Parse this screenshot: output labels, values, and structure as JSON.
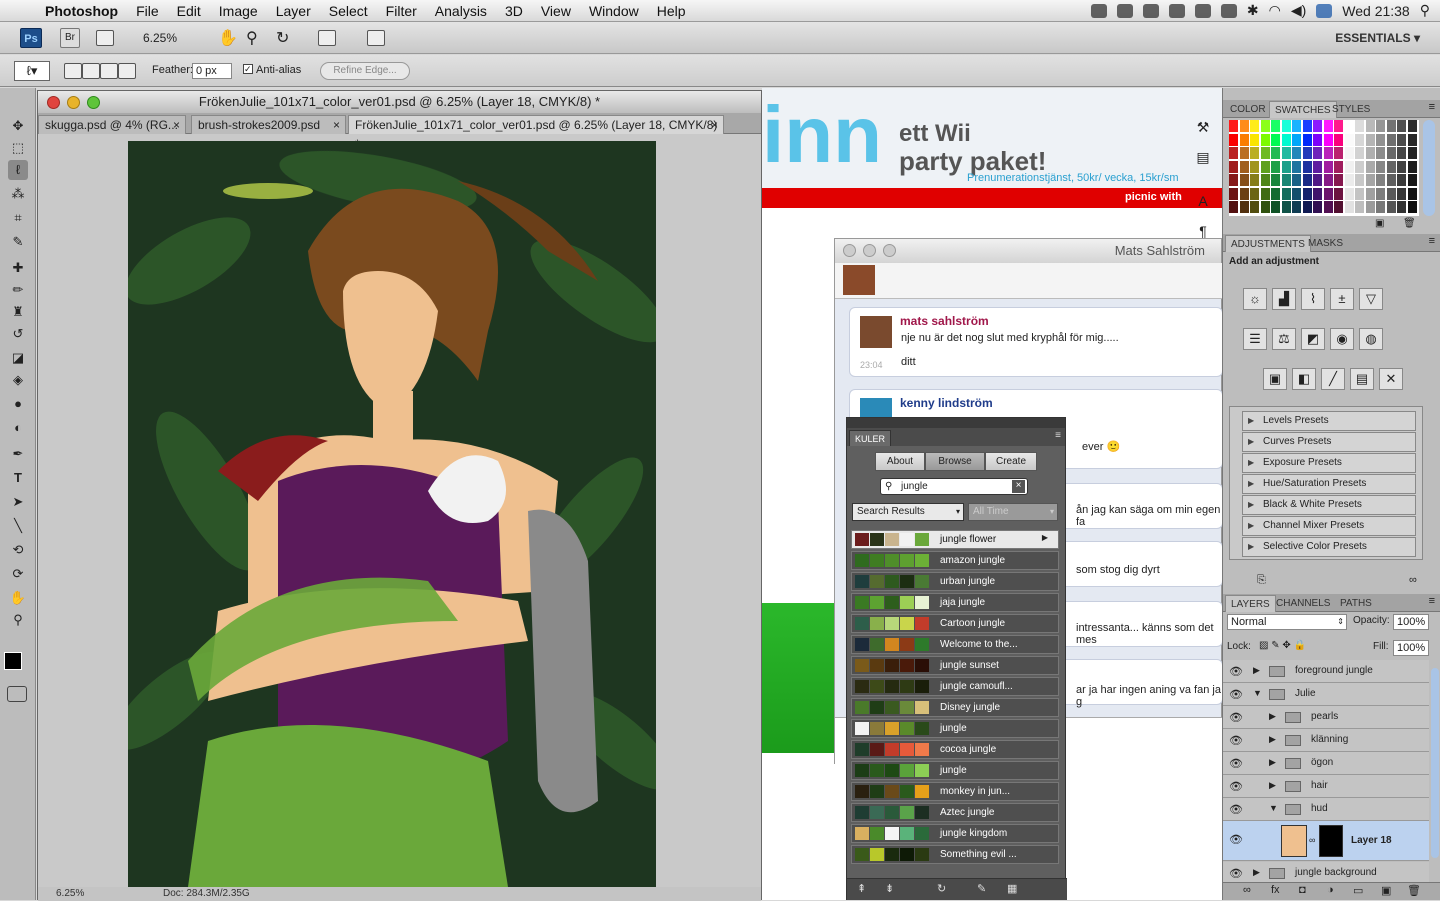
{
  "menubar": {
    "items": [
      "Photoshop",
      "File",
      "Edit",
      "Image",
      "Layer",
      "Select",
      "Filter",
      "Analysis",
      "3D",
      "View",
      "Window",
      "Help"
    ],
    "clock": "Wed 21:38"
  },
  "appbar": {
    "ps": "Ps",
    "br": "Br",
    "zoom": "6.25%",
    "workspace": "ESSENTIALS ▾"
  },
  "options": {
    "feather_label": "Feather:",
    "feather_value": "0 px",
    "antialias": "Anti-alias",
    "refine": "Refine Edge..."
  },
  "doc": {
    "title": "FrökenJulie_101x71_color_ver01.psd @ 6.25% (Layer 18, CMYK/8) *",
    "tabs": [
      "skugga.psd @ 4% (RG...",
      "brush-strokes2009.psd",
      "FrökenJulie_101x71_color_ver01.psd @ 6.25% (Layer 18, CMYK/8) *"
    ],
    "status_zoom": "6.25%",
    "status_doc": "Doc: 284.3M/2.35G"
  },
  "web": {
    "banner_line1": "ett Wii",
    "banner_line2": "party paket!",
    "banner_sub": "Prenumerationstjänst, 50kr/ vecka, 15kr/sm",
    "redbar": "picnic with",
    "logo": "inn"
  },
  "chat": {
    "title": "Mats Sahlström",
    "messages": [
      {
        "name": "mats sahlström",
        "lines": [
          "nje nu är det nog slut med kryphål för mig.....",
          "ditt"
        ],
        "time": "23:04"
      },
      {
        "name": "kenny lindström",
        "lines": [
          "ever 🙂"
        ]
      }
    ],
    "fragments": [
      "ån jag kan säga om min egen fa",
      "som stog dig dyrt",
      "intressanta... känns som det mes",
      "ar ja har ingen aning va fan ja g"
    ]
  },
  "kuler": {
    "tab": "KULER",
    "buttons": [
      "About",
      "Browse",
      "Create"
    ],
    "search": "jungle",
    "filter1": "Search Results",
    "filter2": "All Time",
    "themes": [
      {
        "name": "jungle flower",
        "colors": [
          "#6b1c1c",
          "#2a3318",
          "#c9b48e",
          "#f2f2f2",
          "#6aa83a"
        ]
      },
      {
        "name": "amazon jungle",
        "colors": [
          "#2f6b1f",
          "#3f7d22",
          "#4f8e2a",
          "#5ea030",
          "#6cb136"
        ]
      },
      {
        "name": "urban jungle",
        "colors": [
          "#1f3d3d",
          "#556b2f",
          "#2e5a1f",
          "#1c2e12",
          "#4a7a34"
        ]
      },
      {
        "name": "jaja jungle",
        "colors": [
          "#3a7a23",
          "#5da331",
          "#2d5e1c",
          "#9ccf55",
          "#e8f3d4"
        ]
      },
      {
        "name": "Cartoon jungle",
        "colors": [
          "#2d5e4a",
          "#89b04b",
          "#b7d77a",
          "#c9d54b",
          "#c23c2a"
        ]
      },
      {
        "name": "Welcome to the...",
        "colors": [
          "#1c2a3a",
          "#3e6b2c",
          "#d2861f",
          "#8c3a16",
          "#2d7a2a"
        ]
      },
      {
        "name": "jungle sunset",
        "colors": [
          "#7a5a1a",
          "#5a3a10",
          "#3a1e0a",
          "#4a1a0a",
          "#2a0e06"
        ]
      },
      {
        "name": "jungle camoufl...",
        "colors": [
          "#2b2b12",
          "#3d4a18",
          "#252a10",
          "#2e3a14",
          "#1a1e0a"
        ]
      },
      {
        "name": "Disney  jungle",
        "colors": [
          "#4a7a2a",
          "#1f3d16",
          "#3a5a20",
          "#6a8a3a",
          "#d8c07a"
        ]
      },
      {
        "name": "jungle",
        "colors": [
          "#f3f3f3",
          "#8a7a3a",
          "#d9a12a",
          "#5a8a2a",
          "#2a4a1a"
        ]
      },
      {
        "name": "cocoa jungle",
        "colors": [
          "#1f3d2a",
          "#5a1a16",
          "#c23c2a",
          "#e65a3a",
          "#f07a4a"
        ]
      },
      {
        "name": "jungle",
        "colors": [
          "#1c3d16",
          "#2a5a1c",
          "#1e4a14",
          "#5aa33a",
          "#8ccf55"
        ]
      },
      {
        "name": "monkey in  jun...",
        "colors": [
          "#2a2010",
          "#1f3d16",
          "#6a4a1a",
          "#2a5a1c",
          "#e6a01a"
        ]
      },
      {
        "name": "Aztec jungle",
        "colors": [
          "#1f3d33",
          "#3a6a55",
          "#2a5a3a",
          "#5aa34a",
          "#1c2e22"
        ]
      },
      {
        "name": "jungle kingdom",
        "colors": [
          "#d9b060",
          "#4a8a2a",
          "#f5f5f5",
          "#5ab37a",
          "#2a6a3a"
        ]
      },
      {
        "name": "Something evil ...",
        "colors": [
          "#3a5a1a",
          "#b8c82a",
          "#1a2a0e",
          "#0e1a06",
          "#2a3a12"
        ]
      }
    ]
  },
  "swatch_panel": {
    "tabs": [
      "COLOR",
      "SWATCHES",
      "STYLES"
    ]
  },
  "adjustments": {
    "tabs": [
      "ADJUSTMENTS",
      "MASKS"
    ],
    "heading": "Add an adjustment",
    "presets": [
      "Levels Presets",
      "Curves Presets",
      "Exposure Presets",
      "Hue/Saturation Presets",
      "Black & White Presets",
      "Channel Mixer Presets",
      "Selective Color Presets"
    ]
  },
  "layers": {
    "tabs": [
      "LAYERS",
      "CHANNELS",
      "PATHS"
    ],
    "mode": "Normal",
    "opacity_label": "Opacity:",
    "opacity": "100%",
    "lock_label": "Lock:",
    "fill_label": "Fill:",
    "fill": "100%",
    "rows": [
      {
        "name": "foreground jungle",
        "indent": 0,
        "open": false
      },
      {
        "name": "Julie",
        "indent": 0,
        "open": true
      },
      {
        "name": "pearls",
        "indent": 1,
        "open": false
      },
      {
        "name": "klänning",
        "indent": 1,
        "open": false
      },
      {
        "name": "ögon",
        "indent": 1,
        "open": false
      },
      {
        "name": "hair",
        "indent": 1,
        "open": false
      },
      {
        "name": "hud",
        "indent": 1,
        "open": true
      }
    ],
    "active_layer": "Layer 18",
    "bottom_layer": "jungle background"
  },
  "colors": {
    "accent": "#2a73c8",
    "fg": "#000000",
    "bg": "#ffffff",
    "skin": "#efc08f",
    "dress": "#5a1a5a",
    "leaf": "#6aa83a"
  }
}
